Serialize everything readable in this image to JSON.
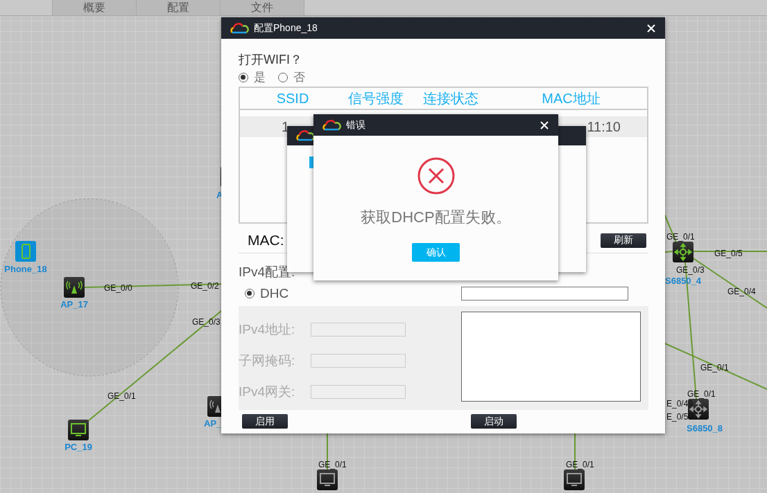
{
  "tabs": [
    {
      "label": "概要"
    },
    {
      "label": "配置"
    },
    {
      "label": "文件"
    }
  ],
  "topology": {
    "nodes": [
      {
        "label": "Phone_18",
        "kind": "phone",
        "active": true
      },
      {
        "label": "AP_17",
        "kind": "ap",
        "active": true
      },
      {
        "label": "PC_19",
        "kind": "pc",
        "active": true
      },
      {
        "label": "AP_",
        "kind": "ap",
        "active": false
      },
      {
        "label": "A",
        "kind": "ap"
      },
      {
        "label": "S6850_4",
        "kind": "switch",
        "active": true
      },
      {
        "label": "S6850_8",
        "kind": "switch",
        "active": false
      },
      {
        "kind": "pc",
        "active": false
      },
      {
        "kind": "pc",
        "active": false
      }
    ],
    "ports": [
      "GE_0/0",
      "GE_0/2",
      "GE_0/3",
      "GE_0/1",
      "GE_0/1",
      "GE_0/5",
      "GE_0/3",
      "GE_0/4",
      "GE_0/1",
      "GE_0/1",
      "E_0/49",
      "E_0/50",
      "GE_0/1",
      "GE_0/1"
    ]
  },
  "config_dialog": {
    "title": "配置Phone_18",
    "wifi_question": "打开WIFI？",
    "wifi_options": [
      {
        "label": "是",
        "selected": true
      },
      {
        "label": "否",
        "selected": false
      }
    ],
    "table": {
      "columns": [
        "SSID",
        "信号强度",
        "连接状态",
        "MAC地址"
      ],
      "rows": [
        {
          "column_1": "1",
          "column_4": "11:10"
        }
      ]
    },
    "mac_label": "MAC:",
    "refresh_button": "刷新",
    "ipv4_label": "IPv4配置:",
    "dhcp_option": {
      "label": "DHC",
      "selected": true
    },
    "static_fields": [
      {
        "label": "IPv4地址:",
        "disabled": true
      },
      {
        "label": "子网掩码:",
        "disabled": true
      },
      {
        "label": "IPv4网关:",
        "disabled": true
      }
    ],
    "enable_button": "启用",
    "start_button": "启动"
  },
  "error_dialog": {
    "title": "错误",
    "message": "获取DHCP配置失败。",
    "confirm_button": "确认"
  }
}
